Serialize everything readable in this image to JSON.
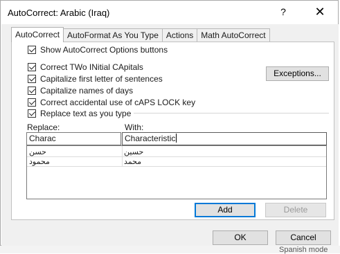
{
  "window": {
    "title": "AutoCorrect: Arabic (Iraq)",
    "help_label": "?",
    "close_label": "✕"
  },
  "tabs": [
    {
      "label": "AutoCorrect",
      "active": true
    },
    {
      "label": "AutoFormat As You Type"
    },
    {
      "label": "Actions"
    },
    {
      "label": "Math AutoCorrect"
    }
  ],
  "options": {
    "show_buttons": {
      "label": "Show AutoCorrect Options buttons",
      "checked": true
    },
    "two_initial_caps": {
      "label": "Correct TWo INitial CApitals",
      "checked": true
    },
    "first_letter": {
      "label": "Capitalize first letter of sentences",
      "checked": true
    },
    "day_names": {
      "label": "Capitalize names of days",
      "checked": true
    },
    "caps_lock": {
      "label": "Correct accidental use of cAPS LOCK key",
      "checked": true
    },
    "replace_text": {
      "label": "Replace text as you type",
      "checked": true
    }
  },
  "exceptions_label": "Exceptions...",
  "replace": {
    "label": "Replace:",
    "value": "Charac"
  },
  "with": {
    "label": "With:",
    "value": "Characteristic"
  },
  "entries": [
    {
      "replace": "حسن",
      "with": "حسين"
    },
    {
      "replace": "محمود",
      "with": "محمد"
    }
  ],
  "add_label": "Add",
  "delete_label": "Delete",
  "ok_label": "OK",
  "cancel_label": "Cancel",
  "background_text": "Spanish mode"
}
